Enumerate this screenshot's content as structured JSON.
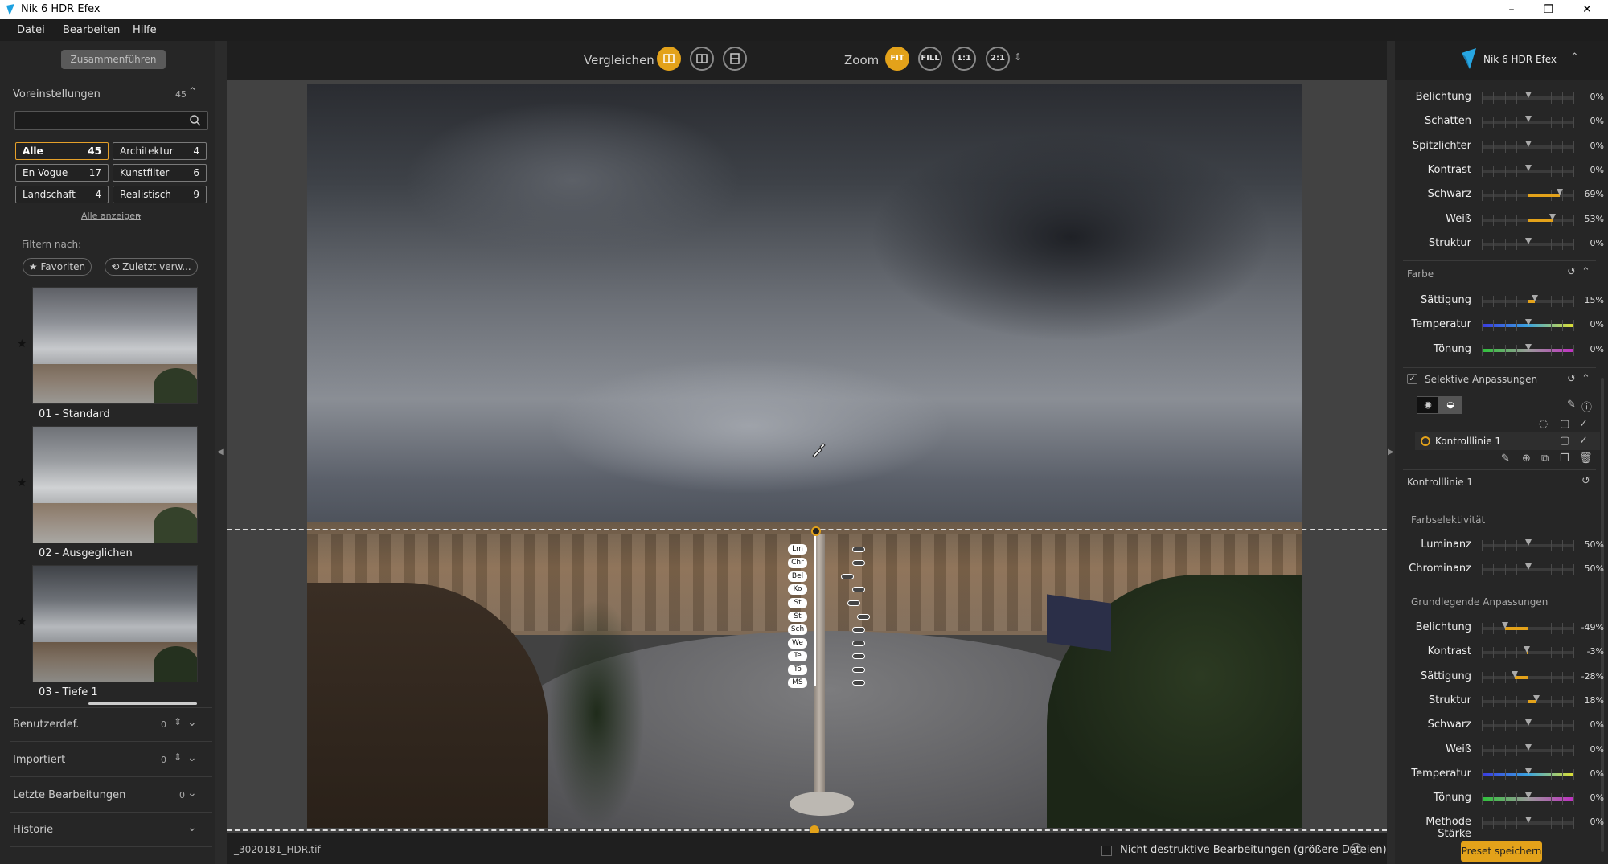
{
  "window": {
    "title": "Nik 6 HDR Efex",
    "min": "–",
    "max": "❐",
    "close": "✕"
  },
  "menu": [
    "Datei",
    "Bearbeiten",
    "Hilfe"
  ],
  "left": {
    "merge_label": "Zusammenführen",
    "presets_label": "Voreinstellungen",
    "presets_count": "45",
    "categories": [
      {
        "name": "Alle",
        "count": "45"
      },
      {
        "name": "Architektur",
        "count": "4"
      },
      {
        "name": "En Vogue",
        "count": "17"
      },
      {
        "name": "Kunstfilter",
        "count": "6"
      },
      {
        "name": "Landschaft",
        "count": "4"
      },
      {
        "name": "Realistisch",
        "count": "9"
      }
    ],
    "show_all": "Alle anzeigen",
    "filter_by": "Filtern nach:",
    "favorites": "★ Favoriten",
    "recent": "⟲ Zuletzt verw...",
    "thumbs": [
      "01 - Standard",
      "02 - Ausgeglichen",
      "03 - Tiefe 1"
    ],
    "sections": [
      {
        "name": "Benutzerdef.",
        "count": "0"
      },
      {
        "name": "Importiert",
        "count": "0"
      },
      {
        "name": "Letzte Bearbeitungen",
        "count": "0"
      },
      {
        "name": "Historie",
        "count": ""
      }
    ]
  },
  "top": {
    "compare": "Vergleichen",
    "zoom": "Zoom",
    "fit": "FIT",
    "fill": "FILL",
    "one": "1:1",
    "two": "2:1"
  },
  "control_labels": [
    "Lm",
    "Chr",
    "Bel",
    "Ko",
    "St",
    "St",
    "Sch",
    "We",
    "Te",
    "Tö",
    "MS"
  ],
  "status": {
    "filename": "_3020181_HDR.tif",
    "nondestructive": "Nicht destruktive Bearbeitungen (größere Dateien)",
    "help": "?"
  },
  "right": {
    "brand": "Nik 6 HDR Efex",
    "tone": [
      {
        "label": "Belichtung",
        "value": "0%",
        "level": 0.5
      },
      {
        "label": "Schatten",
        "value": "0%",
        "level": 0.5
      },
      {
        "label": "Spitzlichter",
        "value": "0%",
        "level": 0.5
      },
      {
        "label": "Kontrast",
        "value": "0%",
        "level": 0.5
      },
      {
        "label": "Schwarz",
        "value": "69%",
        "level": 0.845
      },
      {
        "label": "Weiß",
        "value": "53%",
        "level": 0.765
      },
      {
        "label": "Struktur",
        "value": "0%",
        "level": 0.5
      }
    ],
    "color_section": "Farbe",
    "color": [
      {
        "label": "Sättigung",
        "value": "15%",
        "level": 0.575,
        "kind": "fill"
      },
      {
        "label": "Temperatur",
        "value": "0%",
        "level": 0.5,
        "kind": "temp"
      },
      {
        "label": "Tönung",
        "value": "0%",
        "level": 0.5,
        "kind": "tint"
      }
    ],
    "selective": "Selektive Anpassungen",
    "control_line": "Kontrolllinie 1",
    "control_line2": "Kontrolllinie 1",
    "farbselektivitaet": "Farbselektivität",
    "selectivity": [
      {
        "label": "Luminanz",
        "value": "50%",
        "level": 0.5
      },
      {
        "label": "Chrominanz",
        "value": "50%",
        "level": 0.5
      }
    ],
    "basic": "Grundlegende Anpassungen",
    "basic_adj": [
      {
        "label": "Belichtung",
        "value": "-49%",
        "level": 0.255,
        "kind": "neg"
      },
      {
        "label": "Kontrast",
        "value": "-3%",
        "level": 0.485,
        "kind": "neg"
      },
      {
        "label": "Sättigung",
        "value": "-28%",
        "level": 0.36,
        "kind": "neg"
      },
      {
        "label": "Struktur",
        "value": "18%",
        "level": 0.59,
        "kind": "fill"
      },
      {
        "label": "Schwarz",
        "value": "0%",
        "level": 0.5,
        "kind": "fill"
      },
      {
        "label": "Weiß",
        "value": "0%",
        "level": 0.5,
        "kind": "fill"
      },
      {
        "label": "Temperatur",
        "value": "0%",
        "level": 0.5,
        "kind": "temp"
      },
      {
        "label": "Tönung",
        "value": "0%",
        "level": 0.5,
        "kind": "tint"
      },
      {
        "label": "Methode Stärke",
        "value": "0%",
        "level": 0.5,
        "kind": "fill"
      }
    ],
    "save_preset": "Preset speichern"
  }
}
